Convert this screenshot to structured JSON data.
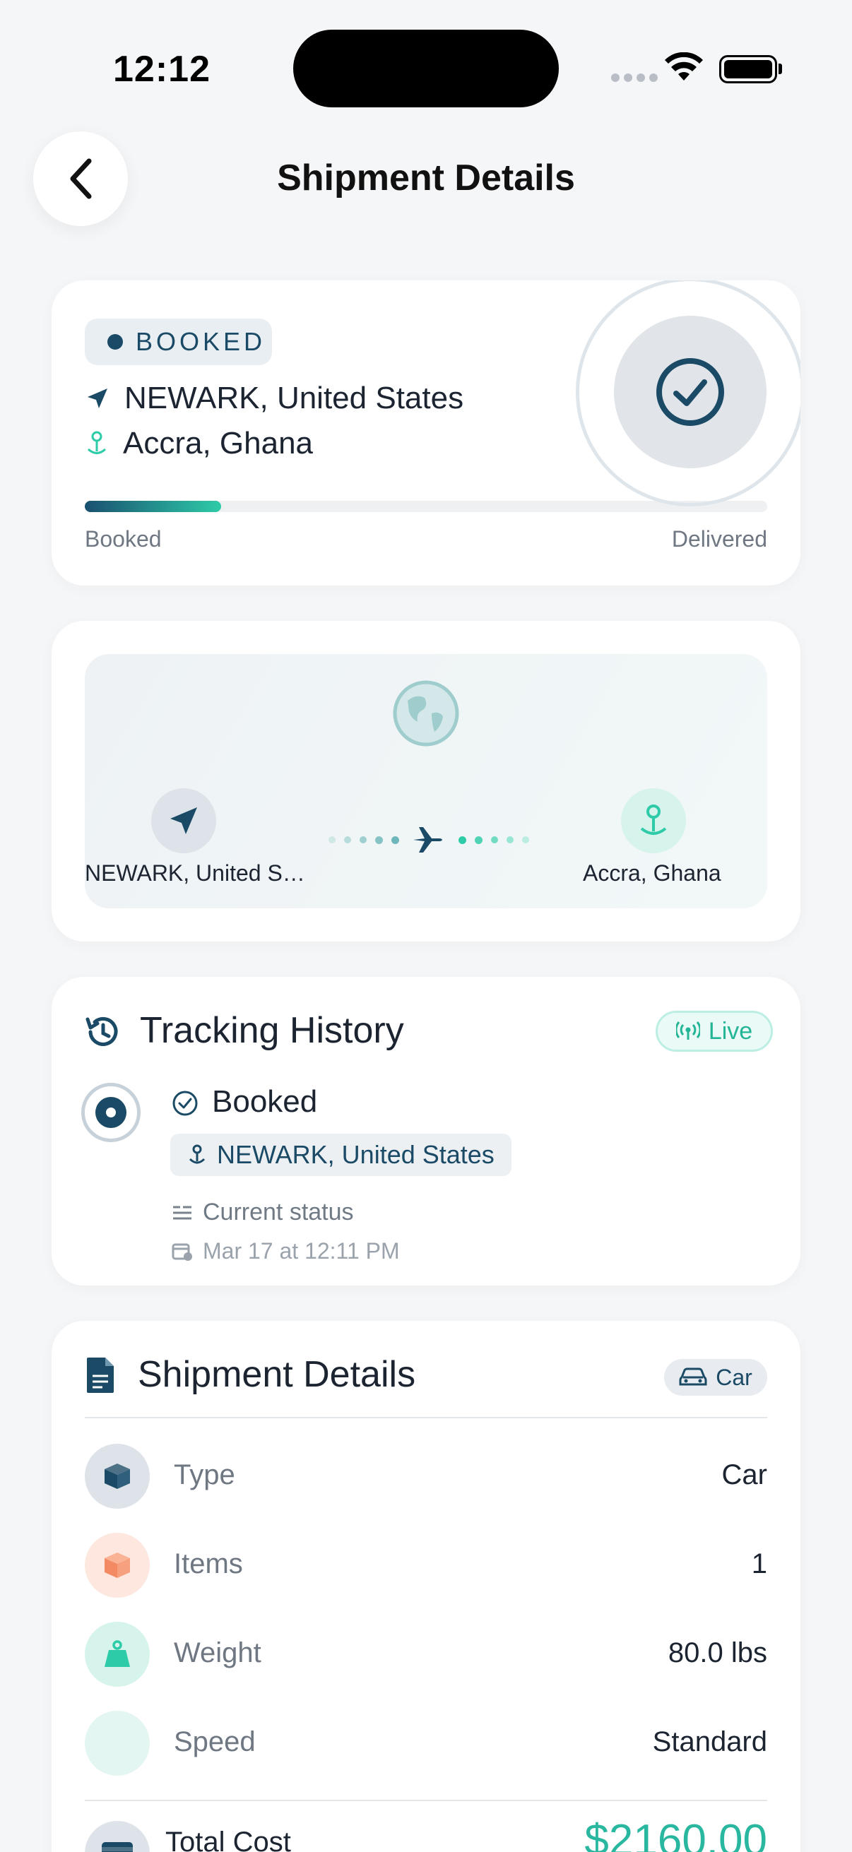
{
  "status_bar": {
    "time": "12:12"
  },
  "header": {
    "title": "Shipment Details"
  },
  "summary": {
    "status": "BOOKED",
    "origin": "NEWARK, United States",
    "destination": "Accra, Ghana",
    "progress": 0.2,
    "start_label": "Booked",
    "end_label": "Delivered"
  },
  "route_map": {
    "origin_label": "NEWARK, United S…",
    "destination_label": "Accra, Ghana"
  },
  "tracking": {
    "title": "Tracking History",
    "live_label": "Live",
    "events": [
      {
        "status": "Booked",
        "location": "NEWARK, United States",
        "note": "Current status",
        "timestamp": "Mar 17 at 12:11 PM"
      }
    ]
  },
  "details": {
    "title": "Shipment Details",
    "vehicle_chip": "Car",
    "rows": [
      {
        "label": "Type",
        "value": "Car"
      },
      {
        "label": "Items",
        "value": "1"
      },
      {
        "label": "Weight",
        "value": "80.0 lbs"
      },
      {
        "label": "Speed",
        "value": "Standard"
      }
    ],
    "total_label": "Total Cost",
    "total_value": "$2160.00"
  },
  "colors": {
    "accent_navy": "#1a4a66",
    "accent_teal": "#2dcba8",
    "background": "#f5f6f8"
  }
}
